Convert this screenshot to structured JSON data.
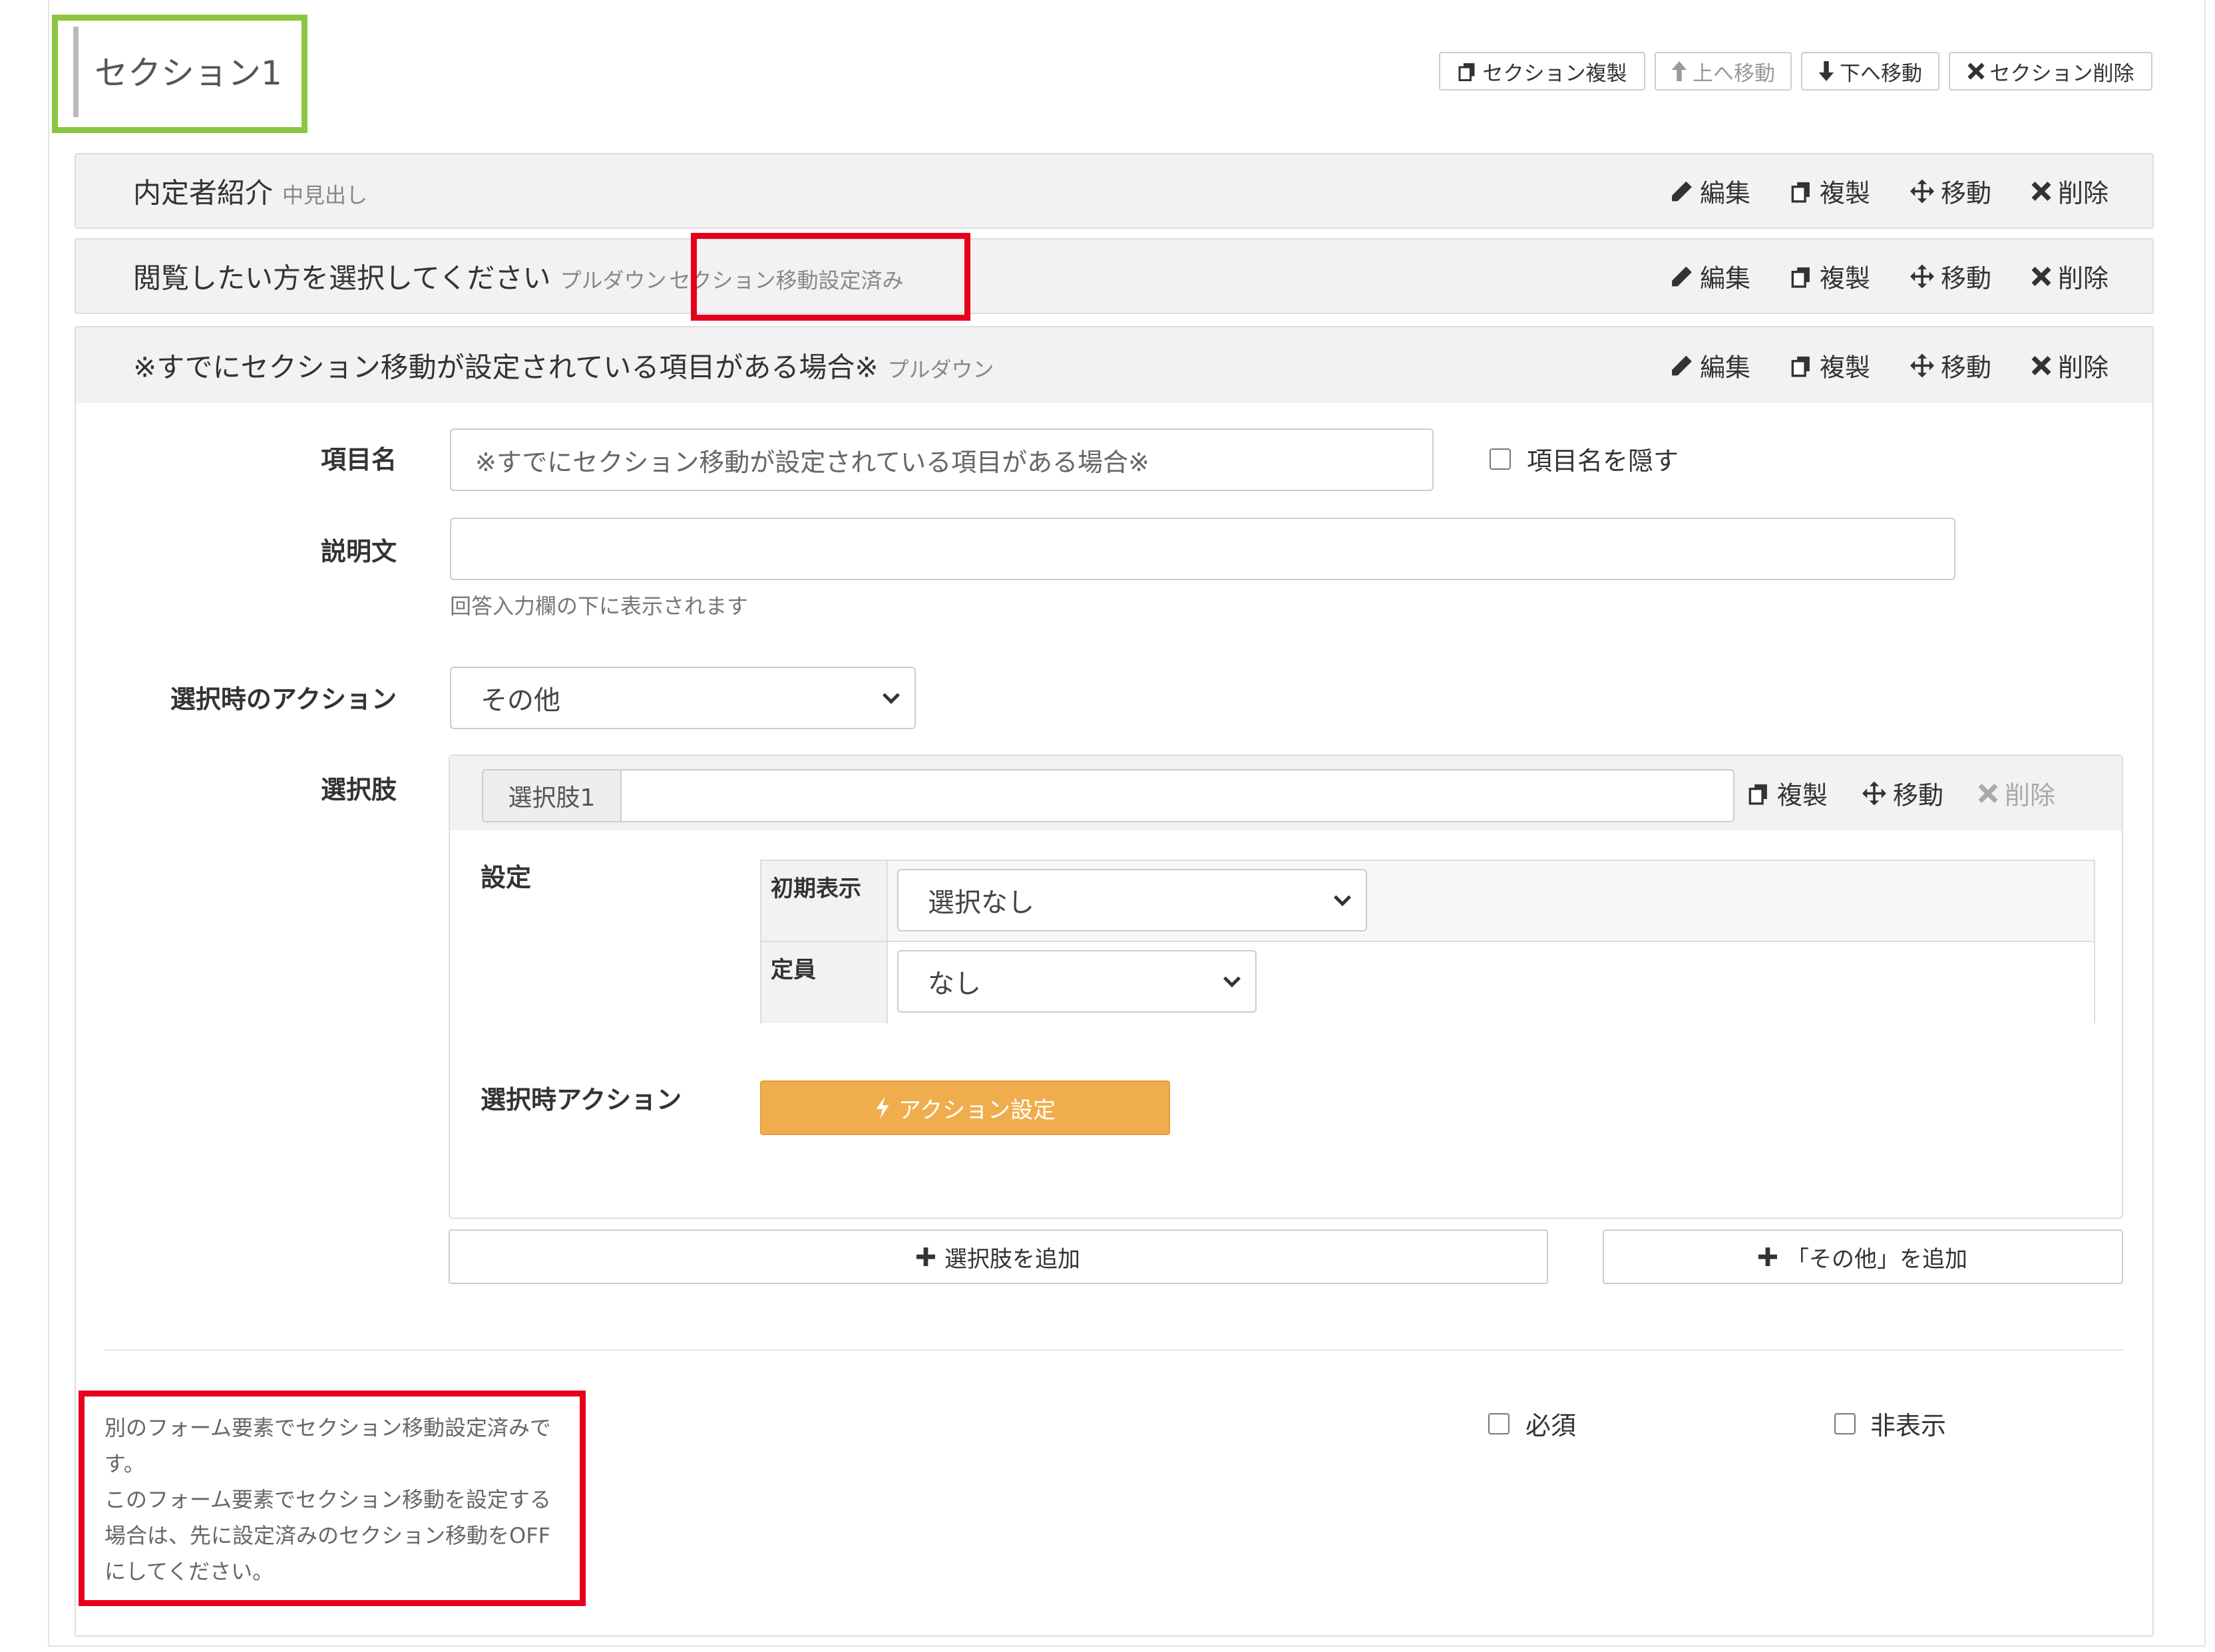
{
  "section": {
    "title": "セクション1",
    "buttons": {
      "duplicate": "セクション複製",
      "move_up": "上へ移動",
      "move_down": "下へ移動",
      "delete": "セクション削除"
    }
  },
  "item_actions": {
    "edit": "編集",
    "duplicate": "複製",
    "move": "移動",
    "delete": "削除"
  },
  "items": [
    {
      "title": "内定者紹介",
      "type": "中見出し"
    },
    {
      "title": "閲覧したい方を選択してください",
      "type": "プルダウン",
      "badge": "セクション移動設定済み"
    },
    {
      "title": "※すでにセクション移動が設定されている項目がある場合※",
      "type": "プルダウン"
    }
  ],
  "form": {
    "item_name_label": "項目名",
    "item_name_value": "※すでにセクション移動が設定されている項目がある場合※",
    "hide_name_label": "項目名を隠す",
    "description_label": "説明文",
    "description_value": "",
    "description_help": "回答入力欄の下に表示されます",
    "select_action_label": "選択時のアクション",
    "select_action_value": "その他",
    "choices_label": "選択肢"
  },
  "choice": {
    "addon": "選択肢1",
    "value": "",
    "duplicate": "複製",
    "move": "移動",
    "delete": "削除",
    "settings_label": "設定",
    "initial_display_label": "初期表示",
    "initial_display_value": "選択なし",
    "capacity_label": "定員",
    "capacity_value": "なし",
    "on_select_action_label": "選択時アクション",
    "action_button": "アクション設定"
  },
  "add_choice_button": "選択肢を追加",
  "add_other_button": "「その他」を追加",
  "required_label": "必須",
  "hidden_label": "非表示",
  "notice": {
    "line1": "別のフォーム要素でセクション移動設定済みで",
    "line2": "す。",
    "line3": "このフォーム要素でセクション移動を設定する",
    "line4": "場合は、先に設定済みのセクション移動をOFF",
    "line5": "にしてください。"
  },
  "colors": {
    "accent_green": "#8cc63f",
    "highlight_red": "#e5001c",
    "action_orange": "#f0ad4e"
  }
}
